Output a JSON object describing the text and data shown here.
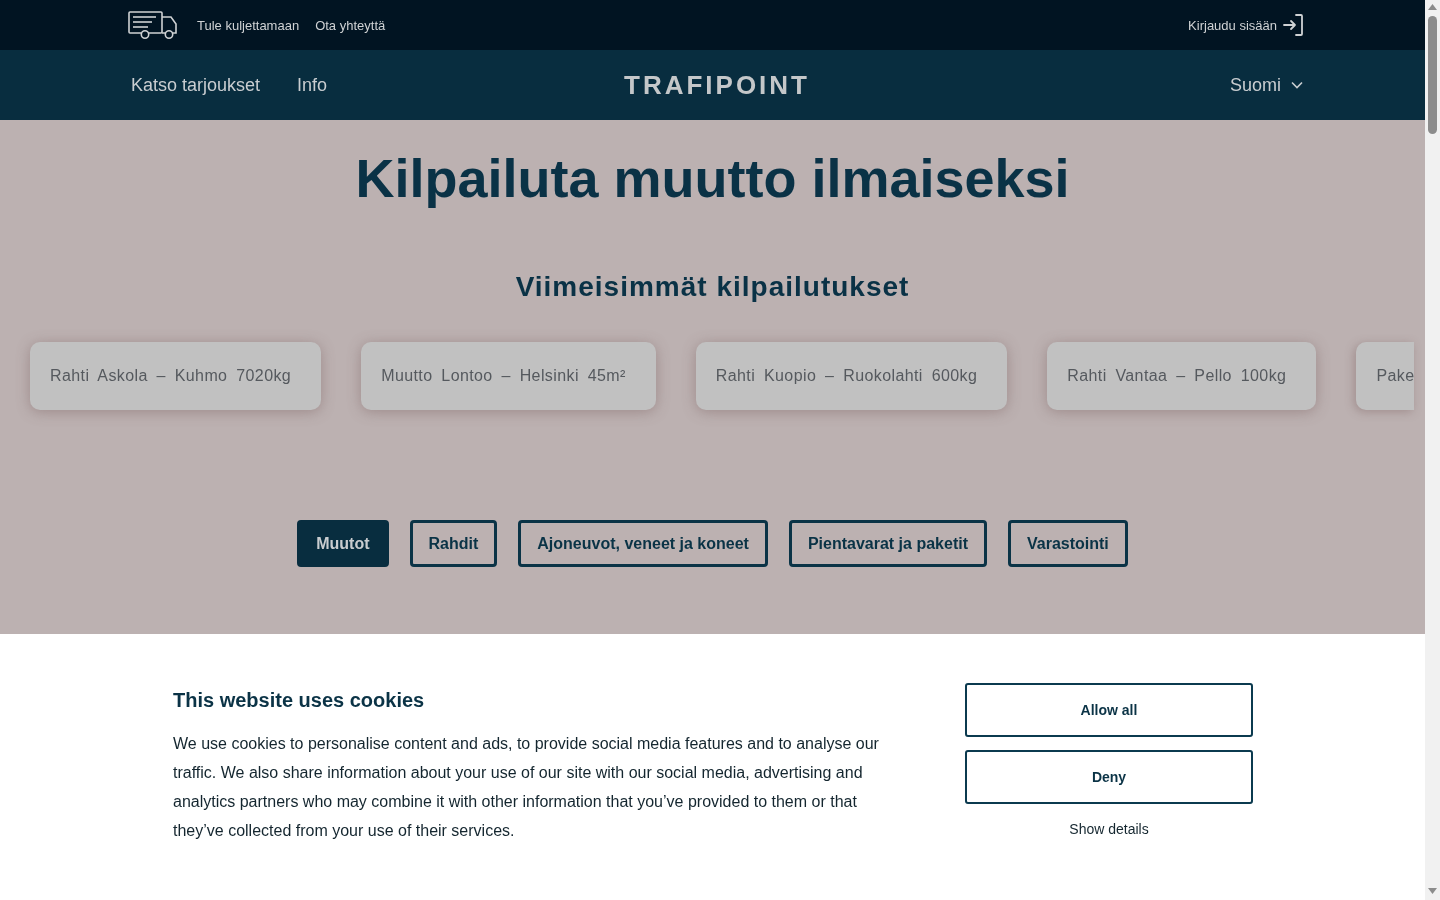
{
  "top_bar": {
    "links": [
      "Tule kuljettamaan",
      "Ota yhteyttä"
    ],
    "login": "Kirjaudu sisään"
  },
  "nav": {
    "links": [
      "Katso tarjoukset",
      "Info"
    ],
    "logo": "TRAFIPOINT",
    "language": "Suomi"
  },
  "hero": {
    "title": "Kilpailuta muutto ilmaiseksi"
  },
  "latest": {
    "heading": "Viimeisimmät kilpailutukset",
    "cards": [
      {
        "text": "Rahti Askola – Kuhmo 7020kg",
        "cut_off": false
      },
      {
        "text": "Muutto Lontoo – Helsinki 45m²",
        "cut_off": false
      },
      {
        "text": "Rahti Kuopio – Ruokolahti 600kg",
        "cut_off": false
      },
      {
        "text": "Rahti Vantaa – Pello 100kg",
        "cut_off": false
      },
      {
        "text": "Pake",
        "cut_off": true
      }
    ]
  },
  "tabs": [
    {
      "label": "Muutot",
      "selected": true
    },
    {
      "label": "Rahdit",
      "selected": false
    },
    {
      "label": "Ajoneuvot, veneet ja koneet",
      "selected": false
    },
    {
      "label": "Pientavarat ja paketit",
      "selected": false
    },
    {
      "label": "Varastointi",
      "selected": false
    }
  ],
  "cookie_banner": {
    "title": "This website uses cookies",
    "text": "We use cookies to personalise content and ads, to provide social media features and to analyse our traffic. We also share information about your use of our site with our social media, advertising and analytics partners who may combine it with other information that you’ve provided to them or that they’ve collected from your use of their services.",
    "buttons": [
      "Allow all",
      "Deny"
    ],
    "details_link": "Show details"
  }
}
